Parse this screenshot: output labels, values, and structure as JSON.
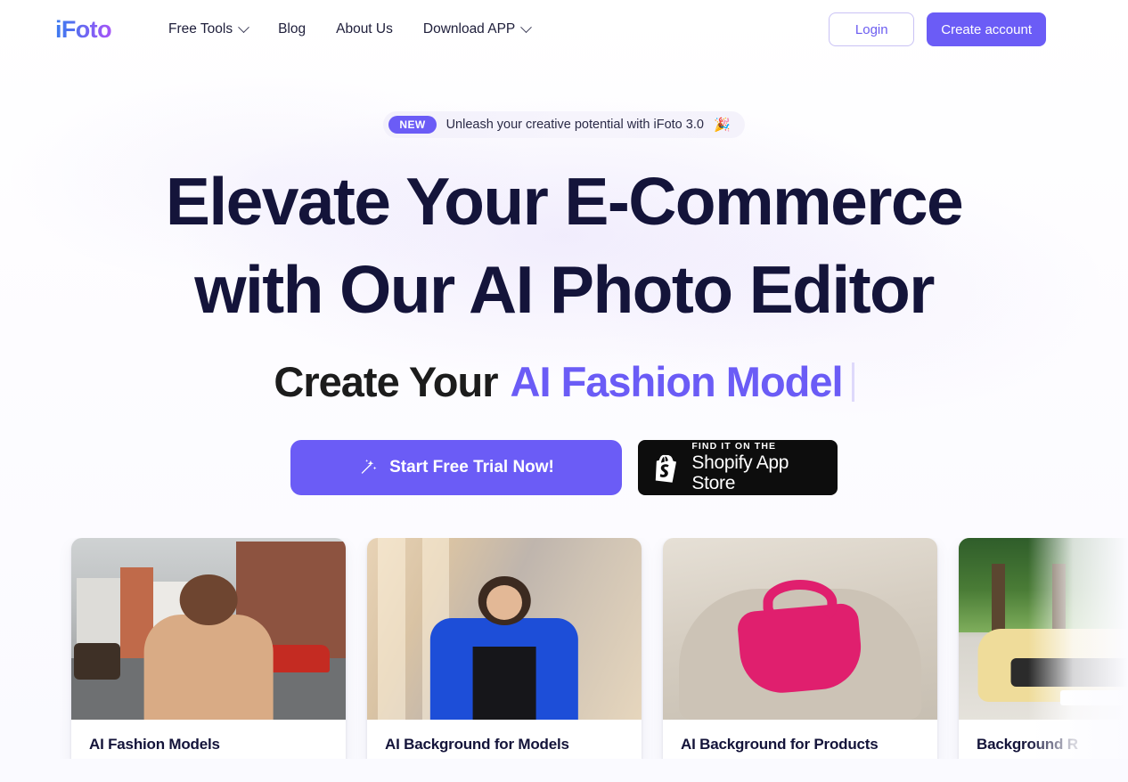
{
  "header": {
    "logo": "iFoto",
    "nav": [
      {
        "label": "Free Tools",
        "has_dropdown": true
      },
      {
        "label": "Blog",
        "has_dropdown": false
      },
      {
        "label": "About Us",
        "has_dropdown": false
      },
      {
        "label": "Download APP",
        "has_dropdown": true
      }
    ],
    "login_label": "Login",
    "create_account_label": "Create account"
  },
  "hero": {
    "badge": "NEW",
    "announcement": "Unleash your creative potential with iFoto 3.0",
    "announcement_emoji": "🎉",
    "headline_line1": "Elevate Your E-Commerce",
    "headline_line2": "with Our AI Photo Editor",
    "subhead_static": "Create Your",
    "subhead_accent": "AI Fashion Model",
    "cta_primary": "Start Free Trial Now!",
    "cta_primary_icon": "magic-wand-icon",
    "shopify_small": "FIND IT ON THE",
    "shopify_large": "Shopify App Store",
    "shopify_icon": "shopify-bag-icon"
  },
  "cards": [
    {
      "title": "AI Fashion Models",
      "image": "street-portrait-photo"
    },
    {
      "title": "AI Background for Models",
      "image": "studio-portrait-photo"
    },
    {
      "title": "AI Background for Products",
      "image": "pink-handbag-photo"
    },
    {
      "title": "Background R",
      "image": "yellow-car-photo"
    }
  ],
  "colors": {
    "brand_purple": "#6b5cf6",
    "logo_blue": "#3b7bf0",
    "logo_purple": "#a855f7",
    "headline_navy": "#14143a",
    "shopify_black": "#0d0d0d",
    "page_background": "#ffffff"
  }
}
